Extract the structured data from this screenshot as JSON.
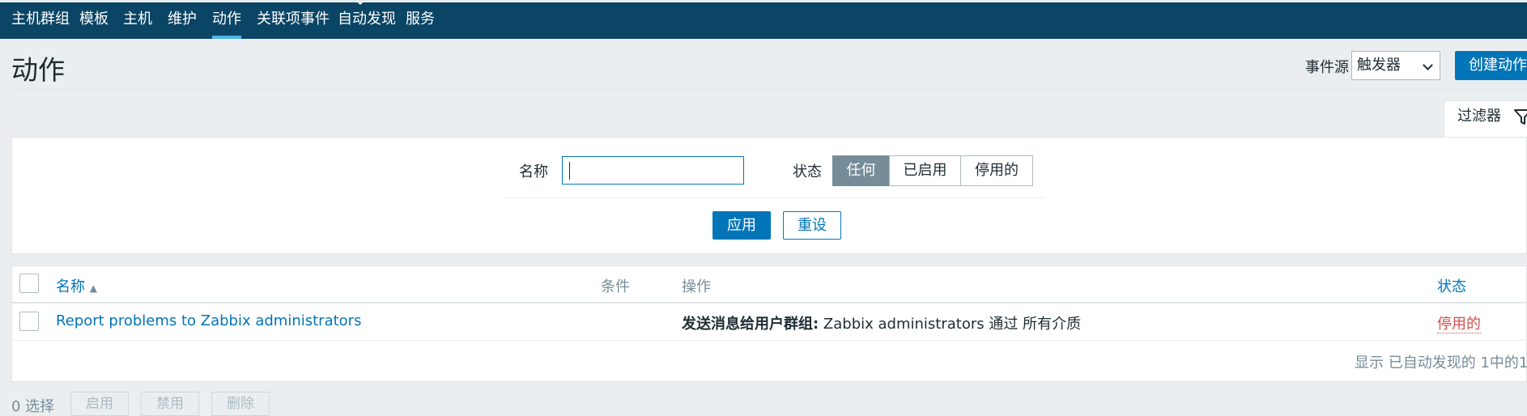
{
  "nav": {
    "items": [
      {
        "label": "主机群组"
      },
      {
        "label": "模板"
      },
      {
        "label": "主机"
      },
      {
        "label": "维护"
      },
      {
        "label": "动作"
      },
      {
        "label": "关联项事件"
      },
      {
        "label": "自动发现"
      },
      {
        "label": "服务"
      }
    ],
    "active": "动作"
  },
  "header": {
    "title": "动作",
    "event_source_label": "事件源",
    "event_source_value": "触发器",
    "create_button": "创建动作"
  },
  "filter": {
    "tab_label": "过滤器",
    "name_label": "名称",
    "name_value": "",
    "status_label": "状态",
    "status_options": [
      "任何",
      "已启用",
      "停用的"
    ],
    "status_selected": "任何",
    "apply_label": "应用",
    "reset_label": "重设"
  },
  "table": {
    "columns": {
      "name": "名称",
      "conditions": "条件",
      "operations": "操作",
      "status": "状态"
    },
    "sort_indicator": "▲",
    "rows": [
      {
        "name": "Report problems to Zabbix administrators",
        "conditions": "",
        "operation_prefix": "发送消息给用户群组:",
        "operation_text": " Zabbix administrators 通过 所有介质",
        "status": "停用的"
      }
    ],
    "summary": "显示 已自动发现的 1中的1"
  },
  "bulk": {
    "selected_text": "0 选择",
    "buttons": [
      "启用",
      "禁用",
      "删除"
    ]
  },
  "colors": {
    "nav_bg": "#0b4566",
    "accent": "#0275b8",
    "disabled_status": "#d64e4e",
    "active_segment": "#768d99"
  }
}
